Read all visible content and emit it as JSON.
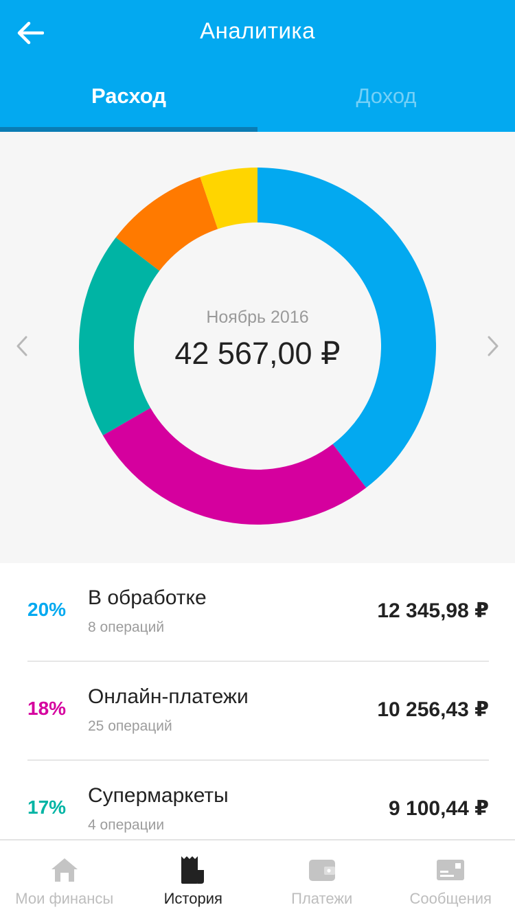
{
  "header": {
    "title": "Аналитика",
    "tabs": [
      {
        "label": "Расход",
        "active": true
      },
      {
        "label": "Доход",
        "active": false
      }
    ],
    "color": "#03a9f0"
  },
  "summary": {
    "period": "Ноябрь 2016",
    "total": "42 567,00 ₽"
  },
  "chart_data": {
    "type": "pie",
    "values": [
      38,
      26,
      18,
      9,
      5
    ],
    "colors": [
      "#03a9f0",
      "#d5009e",
      "#00b4a4",
      "#ff7a00",
      "#ffd500"
    ]
  },
  "categories": [
    {
      "percent": "20%",
      "name": "В обработке",
      "operations": "8 операций",
      "amount": "12 345,98 ₽",
      "color": "#03a9f0"
    },
    {
      "percent": "18%",
      "name": "Онлайн-платежи",
      "operations": "25 операций",
      "amount": "10 256,43 ₽",
      "color": "#d5009e"
    },
    {
      "percent": "17%",
      "name": "Супермаркеты",
      "operations": "4 операции",
      "amount": "9 100,44 ₽",
      "color": "#00b4a4"
    }
  ],
  "bottom_nav": [
    {
      "label": "Мои финансы",
      "icon": "home-icon",
      "active": false
    },
    {
      "label": "История",
      "icon": "receipt-icon",
      "active": true
    },
    {
      "label": "Платежи",
      "icon": "wallet-icon",
      "active": false
    },
    {
      "label": "Сообщения",
      "icon": "message-icon",
      "active": false
    }
  ]
}
